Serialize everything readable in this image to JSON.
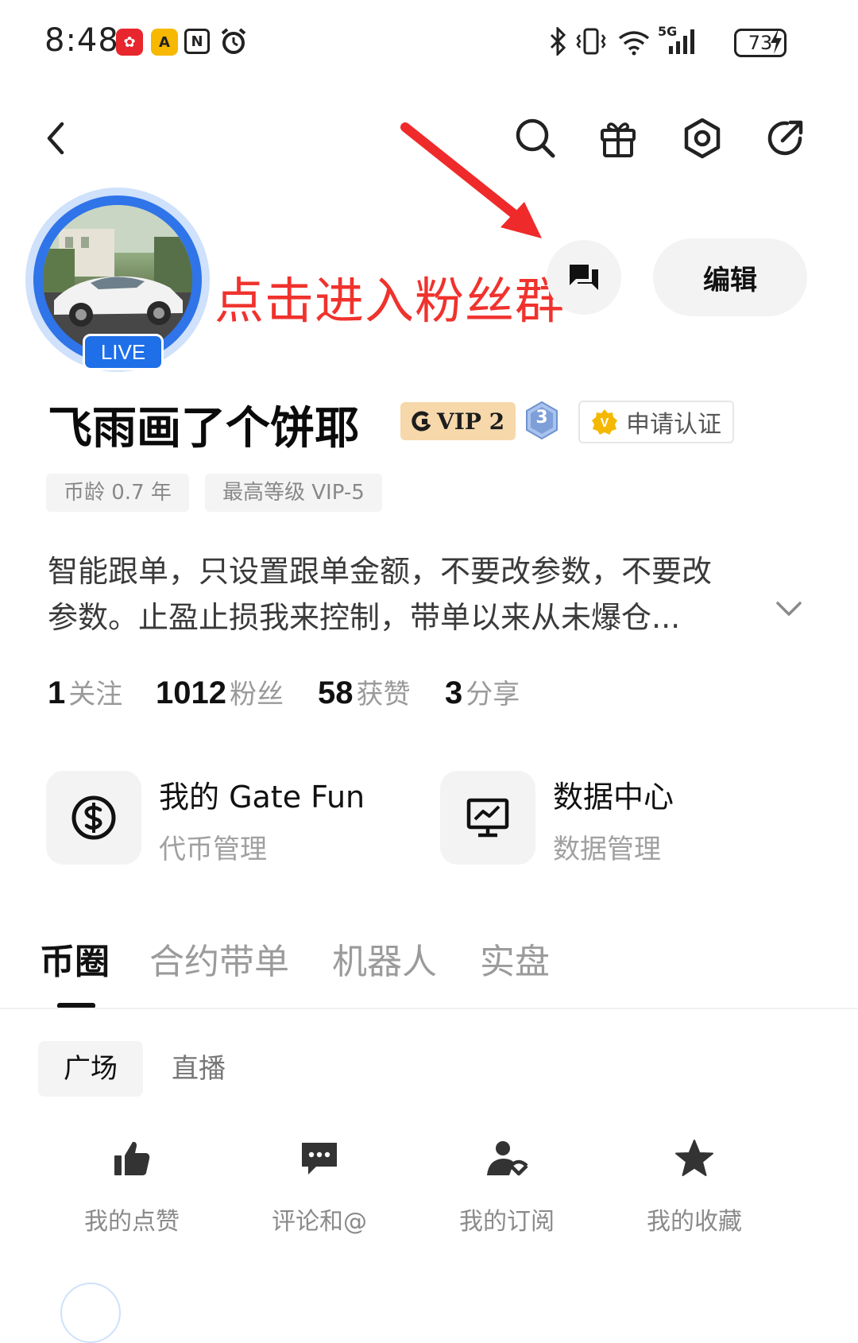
{
  "status_bar": {
    "time": "8:48",
    "network": "5G",
    "battery": "73"
  },
  "annotation": {
    "text": "点击进入粉丝群",
    "color": "#f0322d"
  },
  "profile": {
    "live_label": "LIVE",
    "name": "飞雨画了个饼耶",
    "vip_label": "VIP 2",
    "level": "3",
    "verify_label": "申请认证",
    "edit_label": "编辑",
    "tags": [
      "币龄 0.7 年",
      "最高等级 VIP-5"
    ],
    "bio_lines": [
      "智能跟单，只设置跟单金额，不要改参数，不要改",
      "参数。止盈止损我来控制，带单以来从未爆仓..."
    ]
  },
  "stats": [
    {
      "value": "1",
      "label": "关注"
    },
    {
      "value": "1012",
      "label": "粉丝"
    },
    {
      "value": "58",
      "label": "获赞"
    },
    {
      "value": "3",
      "label": "分享"
    }
  ],
  "tools": [
    {
      "title": "我的 Gate Fun",
      "subtitle": "代币管理",
      "icon": "dollar-circle-icon"
    },
    {
      "title": "数据中心",
      "subtitle": "数据管理",
      "icon": "monitor-chart-icon"
    }
  ],
  "tabs": [
    "币圈",
    "合约带单",
    "机器人",
    "实盘"
  ],
  "subtabs": [
    "广场",
    "直播"
  ],
  "quick_actions": [
    {
      "label": "我的点赞",
      "icon": "thumb-up-icon"
    },
    {
      "label": "评论和@",
      "icon": "comment-icon"
    },
    {
      "label": "我的订阅",
      "icon": "subscribe-user-icon"
    },
    {
      "label": "我的收藏",
      "icon": "star-icon"
    }
  ],
  "colors": {
    "accent_blue": "#2f74e8",
    "vip_gold": "#f6d8ab",
    "verify_gold": "#f5b800"
  }
}
